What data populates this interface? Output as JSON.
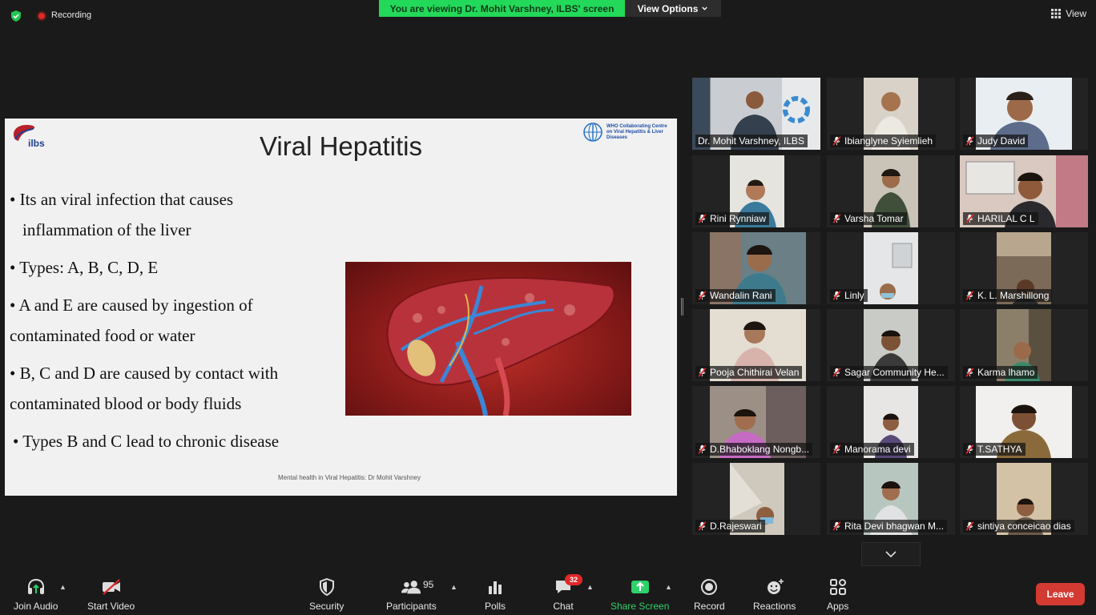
{
  "topbar": {
    "recording_label": "Recording",
    "banner_text": "You are viewing Dr. Mohit Varshney, ILBS' screen",
    "view_options_label": "View Options",
    "view_label": "View"
  },
  "slide": {
    "logo_left_text": "ilbs",
    "logo_right_text": "WHO Collaborating Centre on Viral Hepatitis & Liver Diseases",
    "title": "Viral Hepatitis",
    "bullets": [
      "• Its an viral infection that causes",
      "inflammation of the liver",
      "• Types: A, B, C, D, E",
      "•  A and E are  caused by ingestion of",
      "contaminated food or water",
      "•  B, C and D are caused by contact with",
      "contaminated blood or body fluids",
      "• Types B and C lead to chronic disease"
    ],
    "footer": "Mental health in Viral Hepatitis: Dr Mohit Varshney"
  },
  "participants": [
    {
      "name": "Dr. Mohit Varshney, ILBS",
      "muted": false
    },
    {
      "name": "Ibianglyne Syiemlieh",
      "muted": true
    },
    {
      "name": "Judy David",
      "muted": true
    },
    {
      "name": "Rini Rynniaw",
      "muted": true
    },
    {
      "name": "Varsha Tomar",
      "muted": true
    },
    {
      "name": "HARILAL C L",
      "muted": true
    },
    {
      "name": "Wandalin Rani",
      "muted": true
    },
    {
      "name": "Linly",
      "muted": true
    },
    {
      "name": "K. L. Marshillong",
      "muted": true
    },
    {
      "name": "Pooja Chithirai Velan",
      "muted": true
    },
    {
      "name": "Sagar Community He...",
      "muted": true
    },
    {
      "name": "Karma lhamo",
      "muted": true
    },
    {
      "name": "D.Bhaboklang Nongb...",
      "muted": true
    },
    {
      "name": "Manorama devi",
      "muted": true
    },
    {
      "name": "T.SATHYA",
      "muted": true
    },
    {
      "name": "D.Rajeswari",
      "muted": true
    },
    {
      "name": "Rita Devi bhagwan M...",
      "muted": true
    },
    {
      "name": "sintiya conceicao dias",
      "muted": true
    }
  ],
  "toolbar": {
    "join_audio": "Join Audio",
    "start_video": "Start Video",
    "security": "Security",
    "participants": "Participants",
    "participants_count": "95",
    "polls": "Polls",
    "chat": "Chat",
    "chat_badge": "32",
    "share_screen": "Share Screen",
    "record": "Record",
    "reactions": "Reactions",
    "apps": "Apps",
    "leave": "Leave"
  },
  "colors": {
    "banner_green": "#23d959",
    "active_speaker": "#c8e23a",
    "share_green": "#2ed26b",
    "leave_red": "#d33a32",
    "muted_red": "#e02828"
  }
}
